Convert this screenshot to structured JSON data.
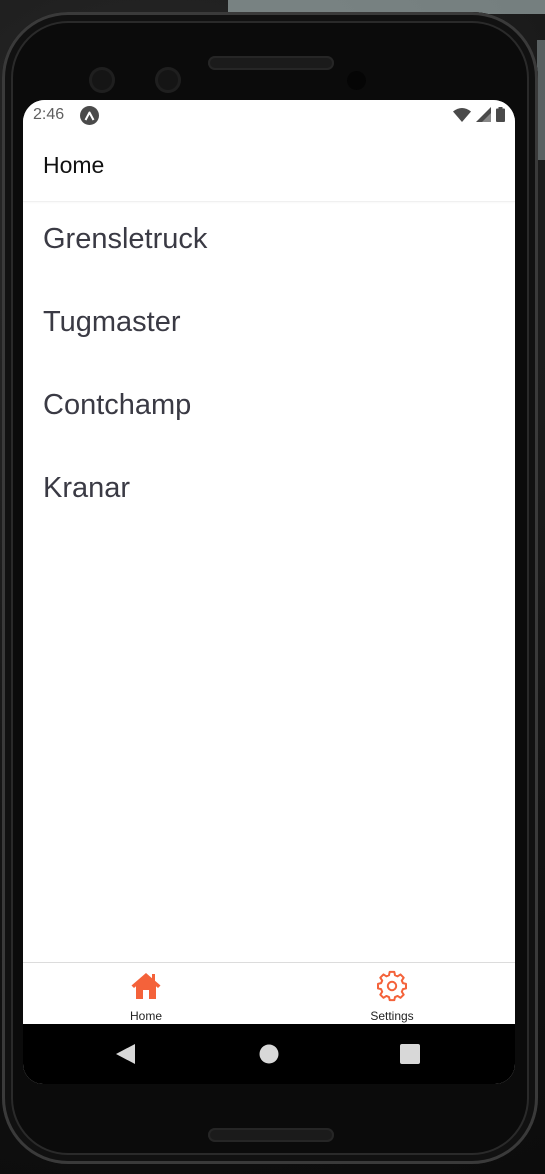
{
  "status_bar": {
    "time": "2:46",
    "app_icon": "expo-a-icon",
    "wifi_icon": "wifi-icon",
    "signal_icon": "cell-signal-icon",
    "battery_icon": "battery-icon"
  },
  "header": {
    "title": "Home"
  },
  "list": {
    "items": [
      {
        "label": "Grensletruck"
      },
      {
        "label": "Tugmaster"
      },
      {
        "label": "Contchamp"
      },
      {
        "label": "Kranar"
      }
    ]
  },
  "tab_bar": {
    "accent_color": "#f4623a",
    "tabs": [
      {
        "label": "Home",
        "icon": "house-icon",
        "active": true
      },
      {
        "label": "Settings",
        "icon": "gear-icon",
        "active": false
      }
    ]
  },
  "system_nav": {
    "back_icon": "back-triangle-icon",
    "home_icon": "home-circle-icon",
    "recents_icon": "recents-square-icon"
  }
}
